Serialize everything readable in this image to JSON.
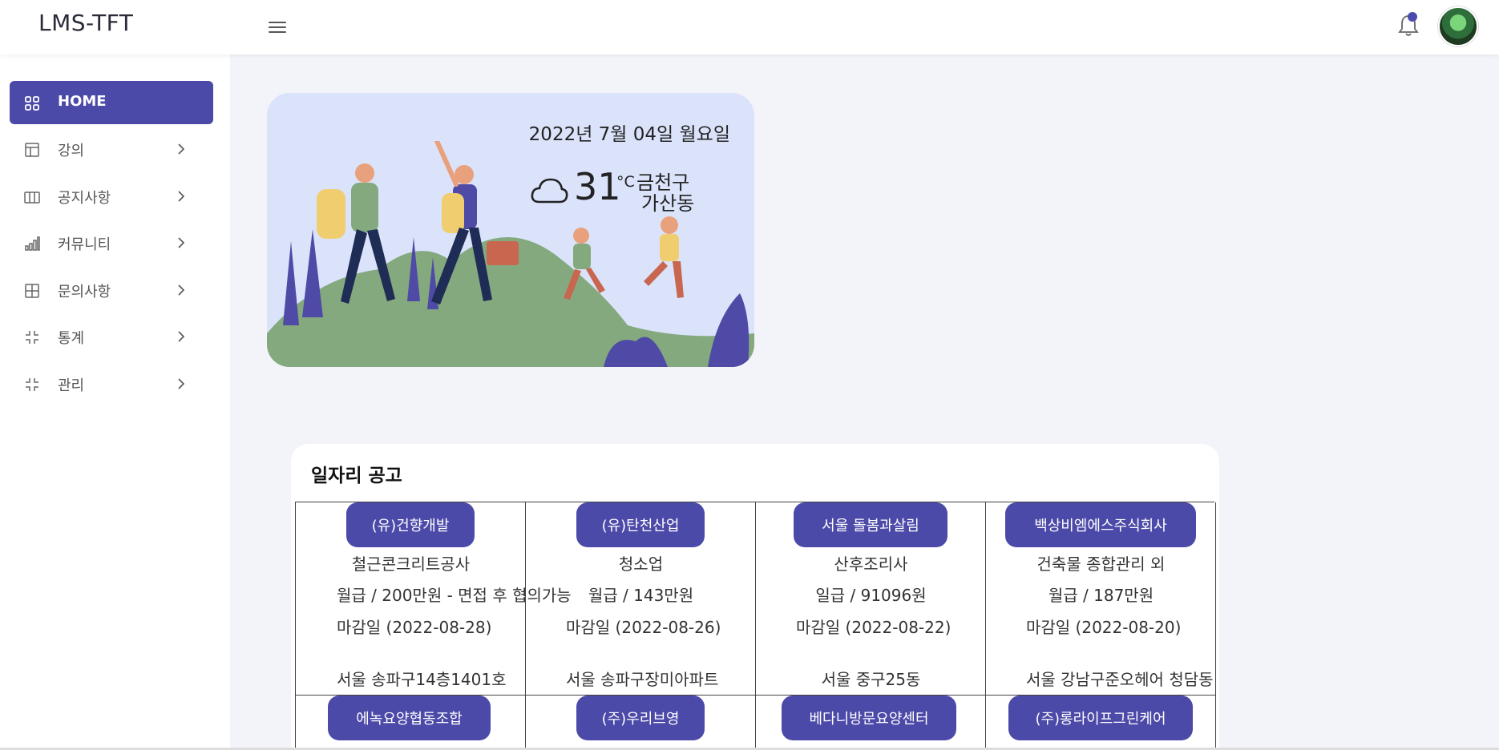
{
  "header": {
    "brand": "LMS-TFT",
    "accent": "#4c4aa8"
  },
  "sidebar": {
    "items": [
      {
        "label": "HOME",
        "icon": "grid-icon",
        "active": true
      },
      {
        "label": "강의",
        "icon": "layout-icon"
      },
      {
        "label": "공지사항",
        "icon": "columns-icon"
      },
      {
        "label": "커뮤니티",
        "icon": "bar-chart-icon"
      },
      {
        "label": "문의사항",
        "icon": "table-icon"
      },
      {
        "label": "통계",
        "icon": "collapse-icon"
      },
      {
        "label": "관리",
        "icon": "collapse-icon"
      }
    ]
  },
  "weather": {
    "date": "2022년 7월 04일 월요일",
    "temp": "31",
    "unit": "°C",
    "district": "금천구",
    "dong": "가산동",
    "icon": "cloud-icon"
  },
  "jobs": {
    "title": "일자리 공고",
    "row1": [
      {
        "company": "(유)건향개발",
        "job": "철근콘크리트공사",
        "pay": "월급 / 200만원 - 면접 후 협의가능",
        "deadline": "마감일 (2022-08-28)",
        "addr": "서울 송파구14층1401호"
      },
      {
        "company": "(유)탄천산업",
        "job": "청소업",
        "pay": "월급 / 143만원",
        "deadline": "마감일 (2022-08-26)",
        "addr": "서울 송파구장미아파트"
      },
      {
        "company": "서울 돌봄과살림",
        "job": "산후조리사",
        "pay": "일급 / 91096원",
        "deadline": "마감일 (2022-08-22)",
        "addr": "서울 중구25동"
      },
      {
        "company": "백상비엠에스주식회사",
        "job": "건축물 종합관리 외",
        "pay": "월급 / 187만원",
        "deadline": "마감일 (2022-08-20)",
        "addr": "서울 강남구준오헤어 청담동"
      }
    ],
    "row2": [
      {
        "company": "에녹요양협동조합"
      },
      {
        "company": "(주)우리브영"
      },
      {
        "company": "베다니방문요양센터"
      },
      {
        "company": "(주)롱라이프그린케어"
      }
    ]
  }
}
